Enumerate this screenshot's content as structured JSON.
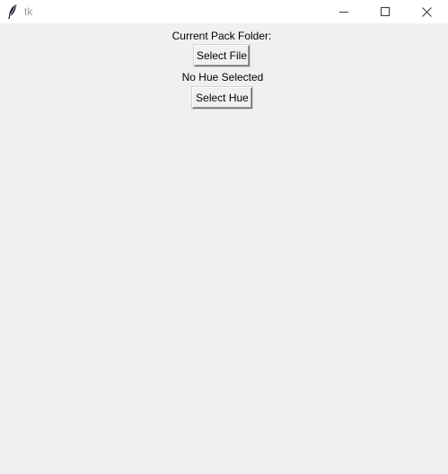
{
  "window": {
    "title": "tk",
    "controls": {
      "minimize_icon": "minimize-icon",
      "maximize_icon": "maximize-icon",
      "close_icon": "close-icon"
    }
  },
  "main": {
    "folder_label": "Current Pack Folder:",
    "select_file_button": "Select File",
    "hue_status": "No Hue Selected",
    "select_hue_button": "Select Hue"
  },
  "colors": {
    "background": "#f0f0f0",
    "titlebar": "#ffffff",
    "title_text": "#9a9a9a"
  }
}
